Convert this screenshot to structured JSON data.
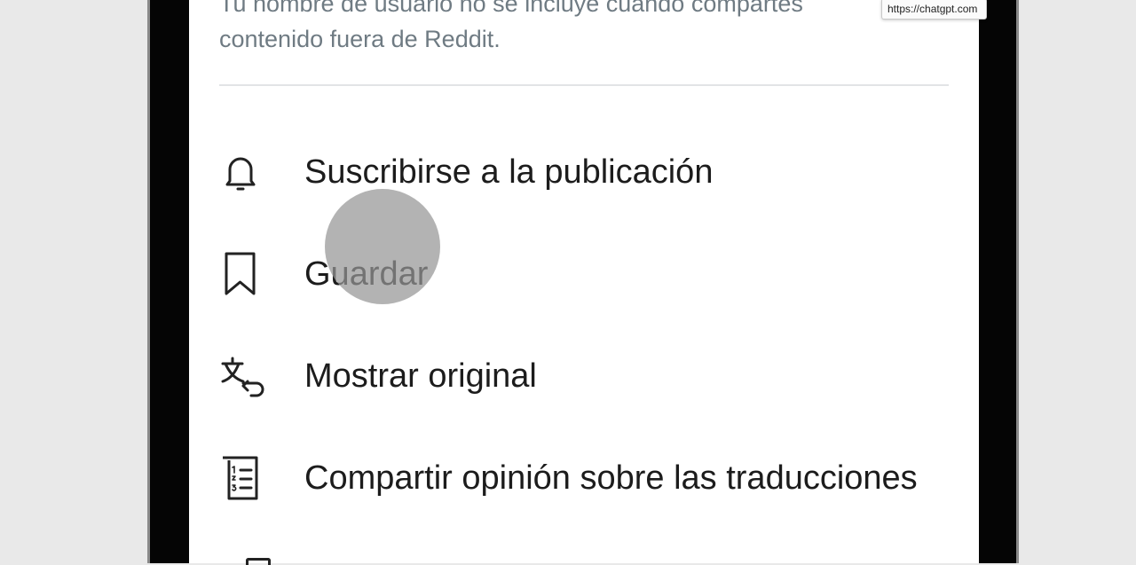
{
  "sheet": {
    "note_text": "Tu nombre de usuario no se incluye cuando compartes\ncontenido fuera de Reddit.",
    "menu": [
      {
        "id": "subscribe",
        "label": "Suscribirse a la publicación",
        "icon": "bell-icon"
      },
      {
        "id": "save",
        "label": "Guardar",
        "icon": "bookmark-icon"
      },
      {
        "id": "show-original",
        "label": "Mostrar original",
        "icon": "translate-icon"
      },
      {
        "id": "translation-feedback",
        "label": "Compartir opinión sobre las traducciones",
        "icon": "numbered-list-icon"
      }
    ]
  },
  "tooltip": {
    "url": "https://chatgpt.com"
  },
  "colors": {
    "text": "#1c1c1c",
    "note": "#6f7b83",
    "divider": "#e2e4e6",
    "touch": "#969696"
  }
}
